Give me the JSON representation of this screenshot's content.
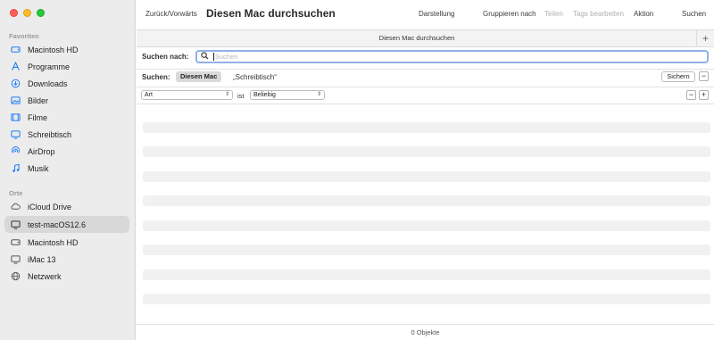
{
  "sidebar": {
    "favorites_title": "Favoriten",
    "places_title": "Orte",
    "favorites": [
      {
        "label": "Macintosh  HD",
        "icon": "hard-drive-icon"
      },
      {
        "label": "Programme",
        "icon": "applications-icon"
      },
      {
        "label": "Downloads",
        "icon": "download-icon"
      },
      {
        "label": "Bilder",
        "icon": "photos-icon"
      },
      {
        "label": "Filme",
        "icon": "movies-icon"
      },
      {
        "label": "Schreibtisch",
        "icon": "desktop-icon"
      },
      {
        "label": "AirDrop",
        "icon": "airdrop-icon"
      },
      {
        "label": "Musik",
        "icon": "music-icon"
      }
    ],
    "places": [
      {
        "label": "iCloud Drive",
        "icon": "cloud-icon"
      },
      {
        "label": "test-macOS12.6",
        "icon": "computer-icon",
        "selected": true
      },
      {
        "label": "Macintosh  HD",
        "icon": "hard-drive-icon"
      },
      {
        "label": "iMac 13",
        "icon": "computer-icon"
      },
      {
        "label": "Netzwerk",
        "icon": "network-icon"
      }
    ],
    "accent_color": "#1a7cf5"
  },
  "toolbar": {
    "back_forward": "Zurück/Vorwärts",
    "title": "Diesen Mac durchsuchen",
    "view": "Darstellung",
    "group_by": "Gruppieren nach",
    "share": "Teilen",
    "edit_tags": "Tags bearbeiten",
    "action": "Aktion",
    "search": "Suchen"
  },
  "tab": {
    "label": "Diesen Mac durchsuchen",
    "add": "+"
  },
  "search": {
    "label": "Suchen nach:",
    "placeholder": "Suchen",
    "value": ""
  },
  "scope": {
    "label": "Suchen:",
    "selected": "Diesen Mac",
    "other": "„Schreibtisch“",
    "save": "Sichern",
    "remove": "−"
  },
  "criteria": {
    "attribute": "Art",
    "operator": "ist",
    "value": "Beliebig",
    "remove": "−",
    "add": "+"
  },
  "status": {
    "count_text": "0 Objekte"
  }
}
